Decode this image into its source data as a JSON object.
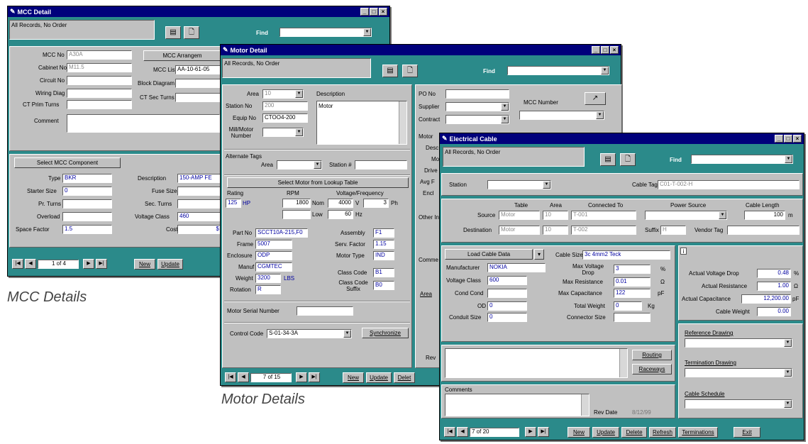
{
  "captions": {
    "mcc": "MCC Details",
    "motor": "Motor Details"
  },
  "common": {
    "records": "All Records, No Order",
    "find": "Find"
  },
  "mcc": {
    "title": "MCC Detail",
    "labels": {
      "mcc_no": "MCC No",
      "cabinet": "Cabinet No",
      "circuit": "Circuit No",
      "wiring": "Wiring Diag",
      "ct_prim": "CT Prim Turns",
      "comment": "Comment",
      "arrangement": "MCC Arrangem",
      "mcc_list": "MCC List",
      "block": "Block Diagram",
      "ct_sec": "CT Sec Turns",
      "select_comp": "Select MCC Component",
      "type": "Type",
      "starter": "Starter Size",
      "pr_turns": "Pr. Turns",
      "overload": "Overload",
      "space": "Space Factor",
      "description": "Description",
      "fuse": "Fuse Size",
      "sec_turns": "Sec. Turns",
      "voltage_class": "Voltage Class",
      "cost": "Cost",
      "new": "New",
      "update": "Update"
    },
    "values": {
      "mcc_no": "A30A",
      "cabinet": "M11.5",
      "mcc_list": "AA-10-61-05",
      "type": "BKR",
      "starter": "0",
      "space": "1.5",
      "description": "150-AMP FE",
      "voltage_class": "460",
      "cost": "$",
      "page": "1 of 4"
    }
  },
  "motor": {
    "title": "Motor Detail",
    "labels": {
      "area": "Area",
      "station_no": "Station No",
      "equip": "Equip No",
      "mill": "Mill/Motor Number",
      "description": "Description",
      "alt_tags": "Alternate Tags",
      "area2": "Area",
      "station2": "Station #",
      "select": "Select Motor from Lookup Table",
      "rating": "Rating",
      "rpm": "RPM",
      "vf": "Voltage/Frequency",
      "nom": "Nom",
      "low": "Low",
      "v": "V",
      "ph": "Ph",
      "hz": "Hz",
      "part": "Part No",
      "frame": "Frame",
      "enclosure": "Enclosure",
      "manuf": "Manuf",
      "weight": "Weight",
      "lbs": "LBS",
      "rotation": "Rotation",
      "assembly": "Assembly",
      "serv_factor": "Serv. Factor",
      "motor_type": "Motor Type",
      "class_code": "Class Code",
      "class_suffix": "Class Code Suffix",
      "serial": "Motor Serial Number",
      "control": "Control Code",
      "synchronize": "Synchronize",
      "po": "PO No",
      "supplier": "Supplier",
      "contract": "Contract",
      "mcc_number": "MCC Number",
      "motor_side": "Motor",
      "desc_side": "Desc",
      "mo": "Mo",
      "drive": "Drive",
      "avg": "Avg F",
      "enc": "Encl",
      "other": "Other In",
      "comm": "Comme",
      "area_side": "Area",
      "rev": "Rev",
      "new": "New",
      "update": "Update",
      "delete": "Delet",
      "hp": "HP"
    },
    "values": {
      "area": "10",
      "station_no": "200",
      "equip": "CTOO4-200",
      "desc_text": "Motor",
      "rating": "125",
      "rpm_nom": "1800",
      "v": "4000",
      "ph": "3",
      "hz": "60",
      "part": "SCCT10A-215,F0",
      "frame": "5007",
      "enclosure": "ODP",
      "manuf": "CGMTEC",
      "weight": "3200",
      "rotation": "R",
      "assembly": "F1",
      "serv_factor": "1.15",
      "motor_type": "IND",
      "class_code": "B1",
      "class_suffix": "B0",
      "control": "S-01-34-3A",
      "page": "7 of 15"
    }
  },
  "cable": {
    "title": "Electrical Cable",
    "labels": {
      "station": "Station",
      "cable_tag": "Cable Tag",
      "table": "Table",
      "area": "Area",
      "connected": "Connected To",
      "power": "Power Source",
      "length": "Cable Length",
      "source": "Source",
      "destination": "Destination",
      "suffix": "Suffix",
      "vendor": "Vendor Tag",
      "load": "Load Cable Data",
      "cable_size": "Cable Size",
      "manufacturer": "Manufacturer",
      "voltage_class": "Voltage Class",
      "cond": "Cond Cond",
      "od": "OD",
      "conduit": "Conduit Size",
      "max_vdrop": "Max Voltage Drop",
      "max_res": "Max Resistance",
      "max_cap": "Max Capacitance",
      "total_weight": "Total Weight",
      "connector": "Connector Size",
      "actual_vdrop": "Actual Voltage Drop",
      "actual_res": "Actual Resistance",
      "actual_cap": "Actual Capacitance",
      "cable_weight": "Cable Weight",
      "ref": "Reference Drawing",
      "term": "Termination Drawing",
      "schedule": "Cable Schedule",
      "routing": "Routing",
      "raceways": "Raceways",
      "comments": "Comments",
      "rev_date": "Rev Date",
      "new": "New",
      "update": "Update",
      "delete": "Delete",
      "refresh": "Refresh",
      "terminations": "Terminations",
      "exit": "Exit",
      "unit_pct": "%",
      "unit_ohm": "Ω",
      "unit_pf": "pF",
      "unit_kg": "Kg",
      "unit_m": "m",
      "unit_pct2": "%",
      "unit_ohm2": "Ω",
      "unit_pf2": "pF"
    },
    "values": {
      "cable_tag": "C01-T-002-H",
      "source_table": "Motor",
      "source_area": "10",
      "source_conn": "T-001",
      "dest_table": "Motor",
      "dest_area": "10",
      "dest_conn": "T-002",
      "suffix": "H",
      "length": "100",
      "cable_size": "3c 4mm2 Teck",
      "manufacturer": "NOKIA",
      "voltage_class": "600",
      "od": "0",
      "conduit": "0",
      "max_vdrop": "3",
      "max_res": "0.01",
      "max_cap": "122",
      "total_weight": "0",
      "actual_vdrop": "0.48",
      "actual_res": "1.00",
      "actual_cap": "12,200.00",
      "cable_weight": "0.00",
      "rev_date": "8/12/99",
      "page": "7 of 20"
    }
  }
}
